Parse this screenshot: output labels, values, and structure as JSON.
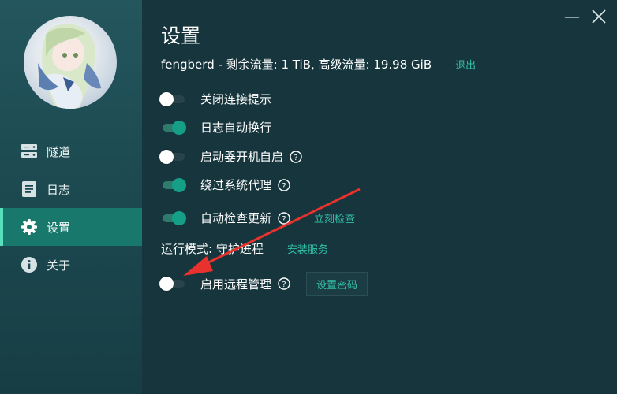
{
  "sidebar": {
    "avatar_icon": "anime-character-avatar",
    "items": [
      {
        "label": "隧道",
        "icon": "server-icon",
        "active": false
      },
      {
        "label": "日志",
        "icon": "document-icon",
        "active": false
      },
      {
        "label": "设置",
        "icon": "gear-icon",
        "active": true
      },
      {
        "label": "关于",
        "icon": "info-icon",
        "active": false
      }
    ]
  },
  "window": {
    "minimize_icon": "minimize-icon",
    "close_icon": "close-icon"
  },
  "settings": {
    "title": "设置",
    "account": "fengberd - 剩余流量: 1 TiB, 高级流量: 19.98 GiB",
    "logout_label": "退出",
    "options": [
      {
        "label": "关闭连接提示",
        "on": false,
        "help": false
      },
      {
        "label": "日志自动换行",
        "on": true,
        "help": false
      },
      {
        "label": "启动器开机自启",
        "on": false,
        "help": true
      },
      {
        "label": "绕过系统代理",
        "on": true,
        "help": true
      },
      {
        "label": "自动检查更新",
        "on": true,
        "help": true,
        "link": "立刻检查"
      }
    ],
    "run_mode_label": "运行模式: 守护进程",
    "install_service_label": "安装服务",
    "remote": {
      "label": "启用远程管理",
      "on": false,
      "button": "设置密码"
    }
  },
  "colors": {
    "accent": "#17786b",
    "link": "#33c0a6",
    "annotation_arrow": "#e8322d"
  }
}
